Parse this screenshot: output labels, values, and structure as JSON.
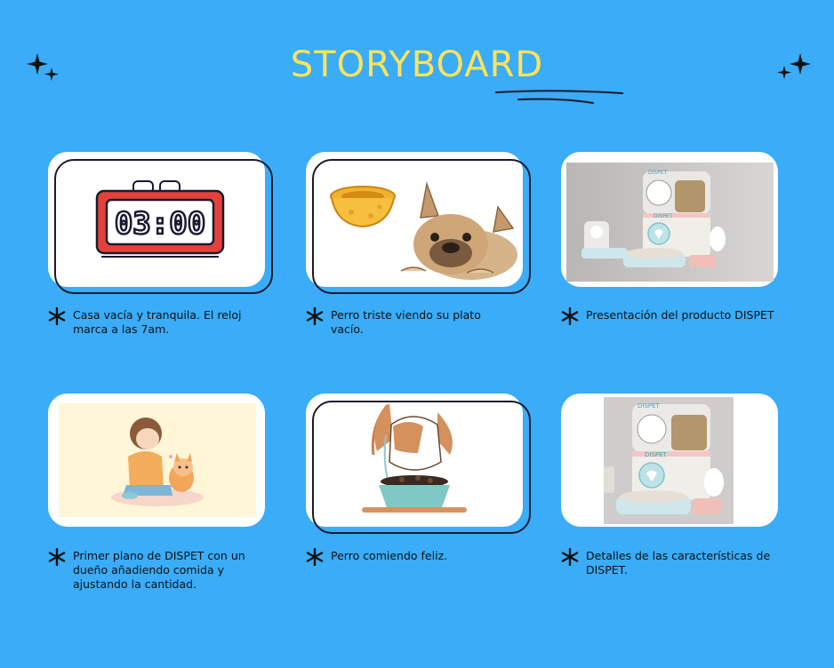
{
  "header": {
    "title": "STORYBOARD"
  },
  "frames": [
    {
      "caption": "Casa vacía y tranquila. El reloj marca a las 7am.",
      "clock_time": "03:00"
    },
    {
      "caption": "Perro triste viendo su plato vacío."
    },
    {
      "caption": "Presentación del producto DISPET",
      "brand_text": "DISPET"
    },
    {
      "caption": "Primer plano de DISPET con un dueño añadiendo comida y ajustando la cantidad."
    },
    {
      "caption": "Perro comiendo feliz."
    },
    {
      "caption": "Detalles de las características de DISPET.",
      "brand_text": "DISPET"
    }
  ],
  "colors": {
    "background": "#3aacf8",
    "title": "#ffe25a",
    "ink": "#111111"
  }
}
